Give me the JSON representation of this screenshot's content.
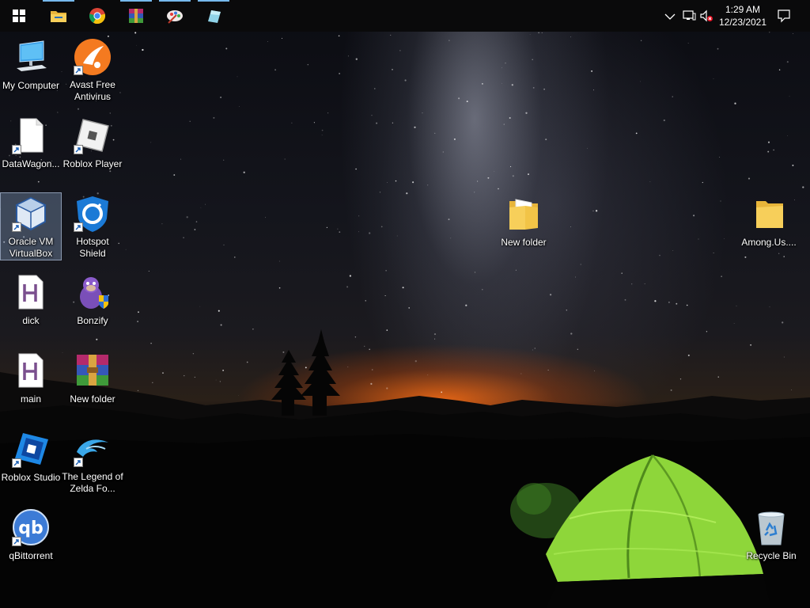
{
  "taskbar": {
    "pinned": [
      {
        "name": "start-button",
        "icon": "windows-logo-icon"
      },
      {
        "name": "file-explorer-button",
        "icon": "folder-icon"
      },
      {
        "name": "chrome-button",
        "icon": "chrome-icon"
      },
      {
        "name": "winrar-button",
        "icon": "winrar-icon"
      },
      {
        "name": "paint-app-button",
        "icon": "paint-palette-icon"
      },
      {
        "name": "app-button",
        "icon": "app-icon"
      }
    ],
    "clock": {
      "time": "1:29 AM",
      "date": "12/23/2021"
    }
  },
  "desktop": {
    "icons": [
      {
        "label": "My Computer",
        "icon": "computer-icon"
      },
      {
        "label": "Avast Free Antivirus",
        "icon": "avast-icon"
      },
      {
        "label": "DataWagon...",
        "icon": "blank-file-icon"
      },
      {
        "label": "Roblox Player",
        "icon": "roblox-player-icon"
      },
      {
        "label": "Oracle VM VirtualBox",
        "icon": "virtualbox-icon"
      },
      {
        "label": "Hotspot Shield",
        "icon": "hotspot-shield-icon"
      },
      {
        "label": "dick",
        "icon": "hex-file-icon"
      },
      {
        "label": "Bonzify",
        "icon": "bonzi-icon"
      },
      {
        "label": "main",
        "icon": "hex-file-icon"
      },
      {
        "label": "New folder",
        "icon": "winrar-archive-icon"
      },
      {
        "label": "Roblox Studio",
        "icon": "roblox-studio-icon"
      },
      {
        "label": "The Legend of Zelda Fo...",
        "icon": "dolphin-icon"
      },
      {
        "label": "qBittorrent",
        "icon": "qbittorrent-icon"
      },
      {
        "label": "New folder",
        "icon": "folder-icon"
      },
      {
        "label": "Among.Us....",
        "icon": "folder-icon"
      },
      {
        "label": "Recycle Bin",
        "icon": "recycle-bin-icon"
      }
    ]
  },
  "colors": {
    "taskbar": "#0a0a0b",
    "accent": "#76b9ed",
    "tent": "#8ed63a",
    "sunset": "#ff7a1e"
  }
}
